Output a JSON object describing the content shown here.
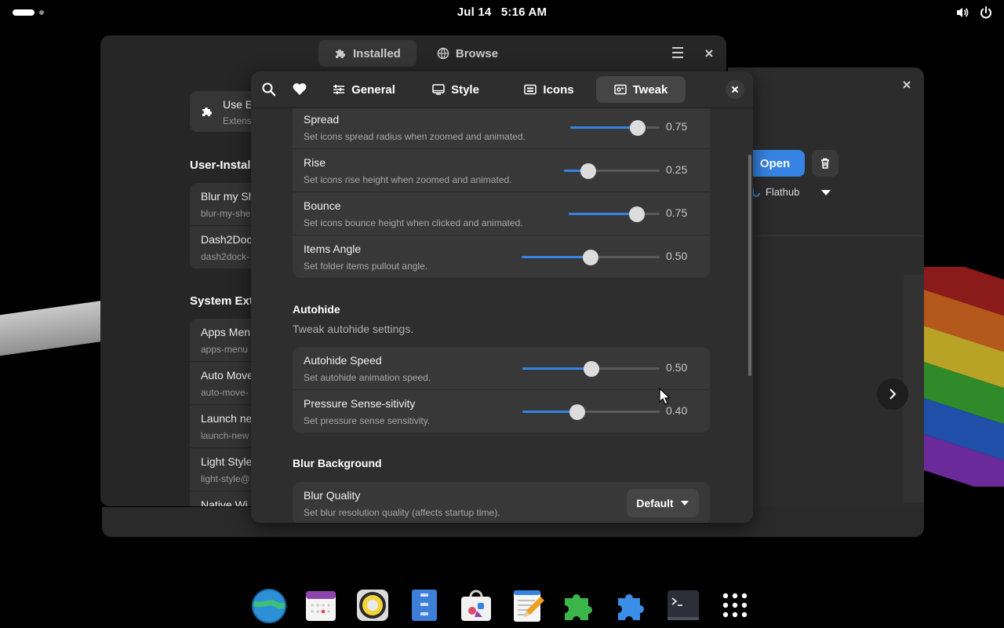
{
  "topbar": {
    "date": "Jul 14",
    "time": "5:16 AM",
    "icons": [
      "volume-icon",
      "power-icon"
    ]
  },
  "back_window": {
    "tabs": [
      {
        "label": "Installed",
        "icon": "puzzle-icon"
      },
      {
        "label": "Browse",
        "icon": "globe-icon"
      }
    ],
    "ext_card": {
      "title": "Use E",
      "subtitle": "Extens"
    },
    "user_installed_header": "User-Install",
    "user_installed": [
      {
        "name": "Blur my Sh",
        "id": "blur-my-she"
      },
      {
        "name": "Dash2Doc",
        "id": "dash2dock-"
      }
    ],
    "system_header": "System Exte",
    "system": [
      {
        "name": "Apps Men",
        "id": "apps-menu"
      },
      {
        "name": "Auto Move",
        "id": "auto-move-"
      },
      {
        "name": "Launch ne",
        "id": "launch-new"
      },
      {
        "name": "Light Style",
        "id": "light-style@"
      },
      {
        "name": "Native Wi",
        "id": ""
      }
    ]
  },
  "side_window": {
    "open_label": "Open",
    "source_label": "Flathub"
  },
  "dialog": {
    "tabs": [
      {
        "label": "General",
        "icon": "sliders-icon"
      },
      {
        "label": "Style",
        "icon": "monitor-icon"
      },
      {
        "label": "Icons",
        "icon": "icons-icon"
      },
      {
        "label": "Tweak",
        "icon": "tweak-icon",
        "active": true
      }
    ],
    "animation_rows": [
      {
        "title": "Spread",
        "subtitle": "Set icons spread radius when zoomed and animated.",
        "value": "0.75",
        "level": 0.75
      },
      {
        "title": "Rise",
        "subtitle": "Set icons rise height when zoomed and animated.",
        "value": "0.25",
        "level": 0.25
      },
      {
        "title": "Bounce",
        "subtitle": "Set icons bounce height when clicked and animated.",
        "value": "0.75",
        "level": 0.75
      },
      {
        "title": "Items Angle",
        "subtitle": "Set folder items pullout angle.",
        "value": "0.50",
        "level": 0.5
      }
    ],
    "autohide": {
      "title": "Autohide",
      "subtitle": "Tweak autohide settings.",
      "rows": [
        {
          "title": "Autohide Speed",
          "subtitle": "Set autohide animation speed.",
          "value": "0.50",
          "level": 0.5
        },
        {
          "title": "Pressure Sense-sitivity",
          "subtitle": "Set pressure sense sensitivity.",
          "value": "0.40",
          "level": 0.4
        }
      ]
    },
    "blur": {
      "title": "Blur Background",
      "rows": [
        {
          "title": "Blur Quality",
          "subtitle": "Set blur resolution quality (affects startup time).",
          "selected": "Default"
        }
      ]
    }
  },
  "dock": {
    "apps": [
      "web-browser-icon",
      "calendar-icon",
      "music-player-icon",
      "file-manager-icon",
      "software-store-icon",
      "text-editor-icon",
      "extensions-icon",
      "extension-manager-icon",
      "terminal-icon",
      "app-grid-icon"
    ]
  },
  "colors": {
    "accent": "#3584e4",
    "dialog_bg": "#2e2e2e",
    "row_bg": "#383838"
  }
}
